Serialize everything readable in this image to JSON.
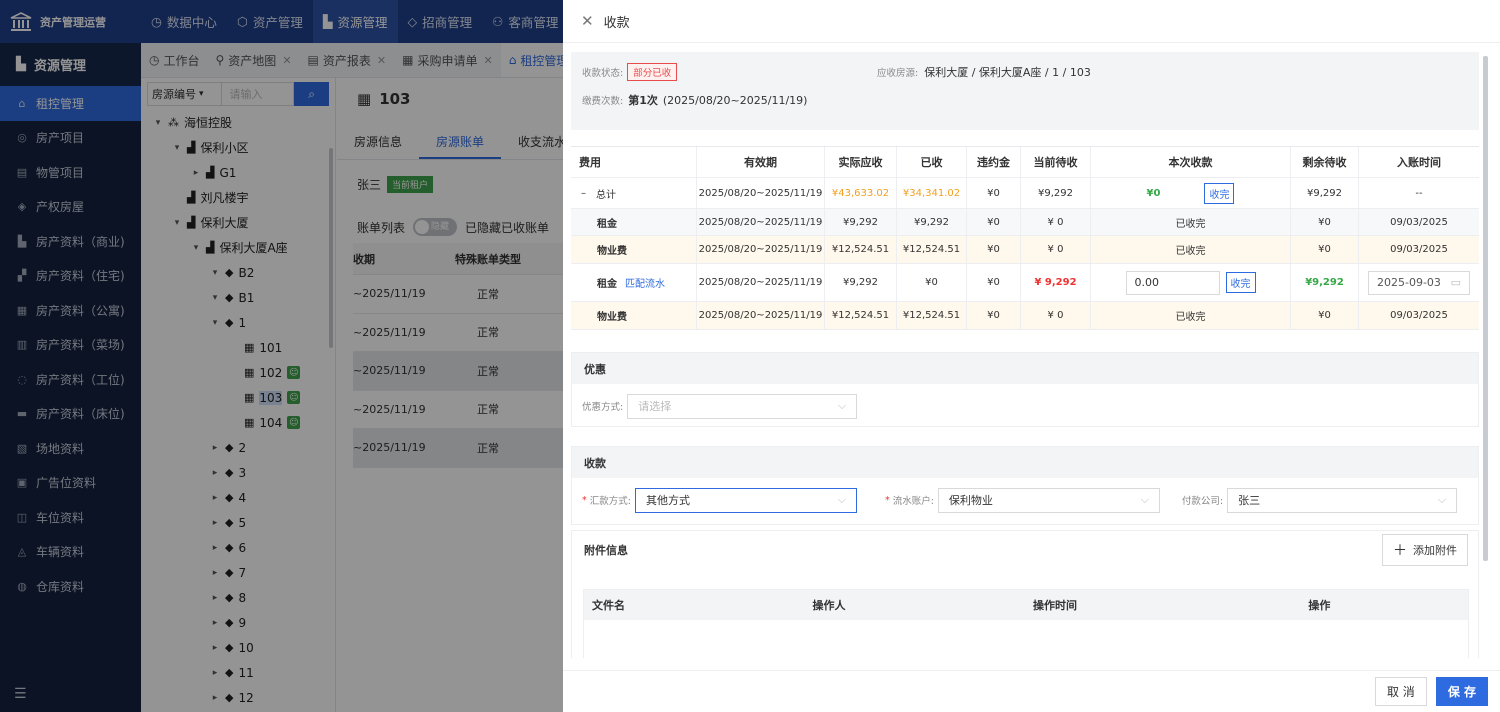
{
  "app": {
    "title": "资产管理运营"
  },
  "topnav": {
    "items": [
      {
        "label": "数据中心",
        "icon": "chart-icon"
      },
      {
        "label": "资产管理",
        "icon": "cube-icon"
      },
      {
        "label": "资源管理",
        "icon": "building-icon",
        "active": true
      },
      {
        "label": "招商管理",
        "icon": "diamond-icon"
      },
      {
        "label": "客商管理",
        "icon": "users-icon"
      }
    ]
  },
  "sidebar": {
    "header": "资源管理",
    "items": [
      {
        "label": "租控管理",
        "active": true
      },
      {
        "label": "房产项目"
      },
      {
        "label": "物管项目"
      },
      {
        "label": "产权房屋"
      },
      {
        "label": "房产资料（商业)"
      },
      {
        "label": "房产资料（住宅)"
      },
      {
        "label": "房产资料（公寓)"
      },
      {
        "label": "房产资料（菜场)"
      },
      {
        "label": "房产资料（工位)"
      },
      {
        "label": "房产资料（床位)"
      },
      {
        "label": "场地资料"
      },
      {
        "label": "广告位资料"
      },
      {
        "label": "车位资料"
      },
      {
        "label": "车辆资料"
      },
      {
        "label": "仓库资料"
      }
    ]
  },
  "tabs": [
    {
      "label": "工作台"
    },
    {
      "label": "资产地图"
    },
    {
      "label": "资产报表"
    },
    {
      "label": "采购申请单"
    },
    {
      "label": "租控管理",
      "active": true
    }
  ],
  "tree": {
    "search_select": "房源编号",
    "search_placeholder": "请输入",
    "nodes": [
      {
        "label": "海恒控股",
        "depth": 0,
        "caret": "▾"
      },
      {
        "label": "保利小区",
        "depth": 1,
        "caret": "▾"
      },
      {
        "label": "G1",
        "depth": 2,
        "caret": "▸"
      },
      {
        "label": "刘凡楼宇",
        "depth": 1,
        "caret": ""
      },
      {
        "label": "保利大厦",
        "depth": 1,
        "caret": "▾"
      },
      {
        "label": "保利大厦A座",
        "depth": 2,
        "caret": "▾"
      },
      {
        "label": "B2",
        "depth": 3,
        "caret": "▾"
      },
      {
        "label": "B1",
        "depth": 3,
        "caret": "▾"
      },
      {
        "label": "1",
        "depth": 3,
        "caret": "▾"
      },
      {
        "label": "101",
        "depth": 4,
        "caret": ""
      },
      {
        "label": "102",
        "depth": 4,
        "caret": "",
        "badge": true
      },
      {
        "label": "103",
        "depth": 4,
        "caret": "",
        "badge": true,
        "selected": true
      },
      {
        "label": "104",
        "depth": 4,
        "caret": "",
        "badge": true
      },
      {
        "label": "2",
        "depth": 3,
        "caret": "▸"
      },
      {
        "label": "3",
        "depth": 3,
        "caret": "▸"
      },
      {
        "label": "4",
        "depth": 3,
        "caret": "▸"
      },
      {
        "label": "5",
        "depth": 3,
        "caret": "▸"
      },
      {
        "label": "6",
        "depth": 3,
        "caret": "▸"
      },
      {
        "label": "7",
        "depth": 3,
        "caret": "▸"
      },
      {
        "label": "8",
        "depth": 3,
        "caret": "▸"
      },
      {
        "label": "9",
        "depth": 3,
        "caret": "▸"
      },
      {
        "label": "10",
        "depth": 3,
        "caret": "▸"
      },
      {
        "label": "11",
        "depth": 3,
        "caret": "▸"
      },
      {
        "label": "12",
        "depth": 3,
        "caret": "▸"
      }
    ]
  },
  "room": {
    "title": "103",
    "subtabs": [
      {
        "label": "房源信息"
      },
      {
        "label": "房源账单",
        "active": true
      },
      {
        "label": "收支流水"
      }
    ],
    "tenant": "张三",
    "tenant_badge": "当前租户",
    "bill_list_label": "账单列表",
    "switch_label": "隐藏",
    "hide_paid_label": "已隐藏已收账单",
    "table_headers": [
      "收期",
      "特殊账单类型"
    ],
    "rows": [
      {
        "period": "~2025/11/19",
        "type": "正常"
      },
      {
        "period": "~2025/11/19",
        "type": "正常"
      },
      {
        "period": "~2025/11/19",
        "type": "正常"
      },
      {
        "period": "~2025/11/19",
        "type": "正常"
      },
      {
        "period": "~2025/11/19",
        "type": "正常"
      }
    ]
  },
  "drawer": {
    "title": "收款",
    "status_label": "收款状态:",
    "status_value": "部分已收",
    "room_label": "应收房源:",
    "room_value": "保利大厦 / 保利大厦A座 / 1 / 103",
    "count_label": "缴费次数:",
    "count_value": "第1次",
    "count_range": "(2025/08/20~2025/11/19)",
    "fee_headers": [
      "费用",
      "有效期",
      "实际应收",
      "已收",
      "违约金",
      "当前待收",
      "本次收款",
      "剩余待收",
      "入账时间"
    ],
    "total": {
      "name": "总计",
      "prefix": "–",
      "period": "2025/08/20~2025/11/19",
      "due": "¥43,633.02",
      "paid": "¥34,341.02",
      "penalty": "¥0",
      "pending": "¥9,292",
      "this_amount": "¥0",
      "btn": "收完",
      "remain": "¥9,292",
      "time": "--"
    },
    "rows": [
      {
        "name": "租金",
        "period": "2025/08/20~2025/11/19",
        "due": "¥9,292",
        "paid": "¥9,292",
        "penalty": "¥0",
        "pending": "¥ 0",
        "this": "已收完",
        "remain": "¥0",
        "time": "09/03/2025"
      },
      {
        "name": "物业费",
        "period": "2025/08/20~2025/11/19",
        "due": "¥12,524.51",
        "paid": "¥12,524.51",
        "penalty": "¥0",
        "pending": "¥ 0",
        "this": "已收完",
        "remain": "¥0",
        "time": "09/03/2025"
      },
      {
        "name": "租金",
        "link": "匹配流水",
        "period": "2025/08/20~2025/11/19",
        "due": "¥9,292",
        "paid": "¥0",
        "penalty": "¥0",
        "pending": "¥ 9,292",
        "input": "0.00",
        "btn": "收完",
        "remain": "¥9,292",
        "date": "2025-09-03"
      },
      {
        "name": "物业费",
        "period": "2025/08/20~2025/11/19",
        "due": "¥12,524.51",
        "paid": "¥12,524.51",
        "penalty": "¥0",
        "pending": "¥ 0",
        "this": "已收完",
        "remain": "¥0",
        "time": "09/03/2025"
      }
    ],
    "discount": {
      "title": "优惠",
      "label": "优惠方式:",
      "placeholder": "请选择"
    },
    "collect": {
      "title": "收款",
      "method_label": "汇款方式:",
      "method_value": "其他方式",
      "account_label": "流水账户:",
      "account_value": "保利物业",
      "company_label": "付款公司:",
      "company_value": "张三"
    },
    "attach": {
      "title": "附件信息",
      "add_btn": "添加附件",
      "headers": [
        "文件名",
        "操作人",
        "操作时间",
        "操作"
      ]
    },
    "footer": {
      "cancel": "取 消",
      "save": "保 存"
    }
  }
}
